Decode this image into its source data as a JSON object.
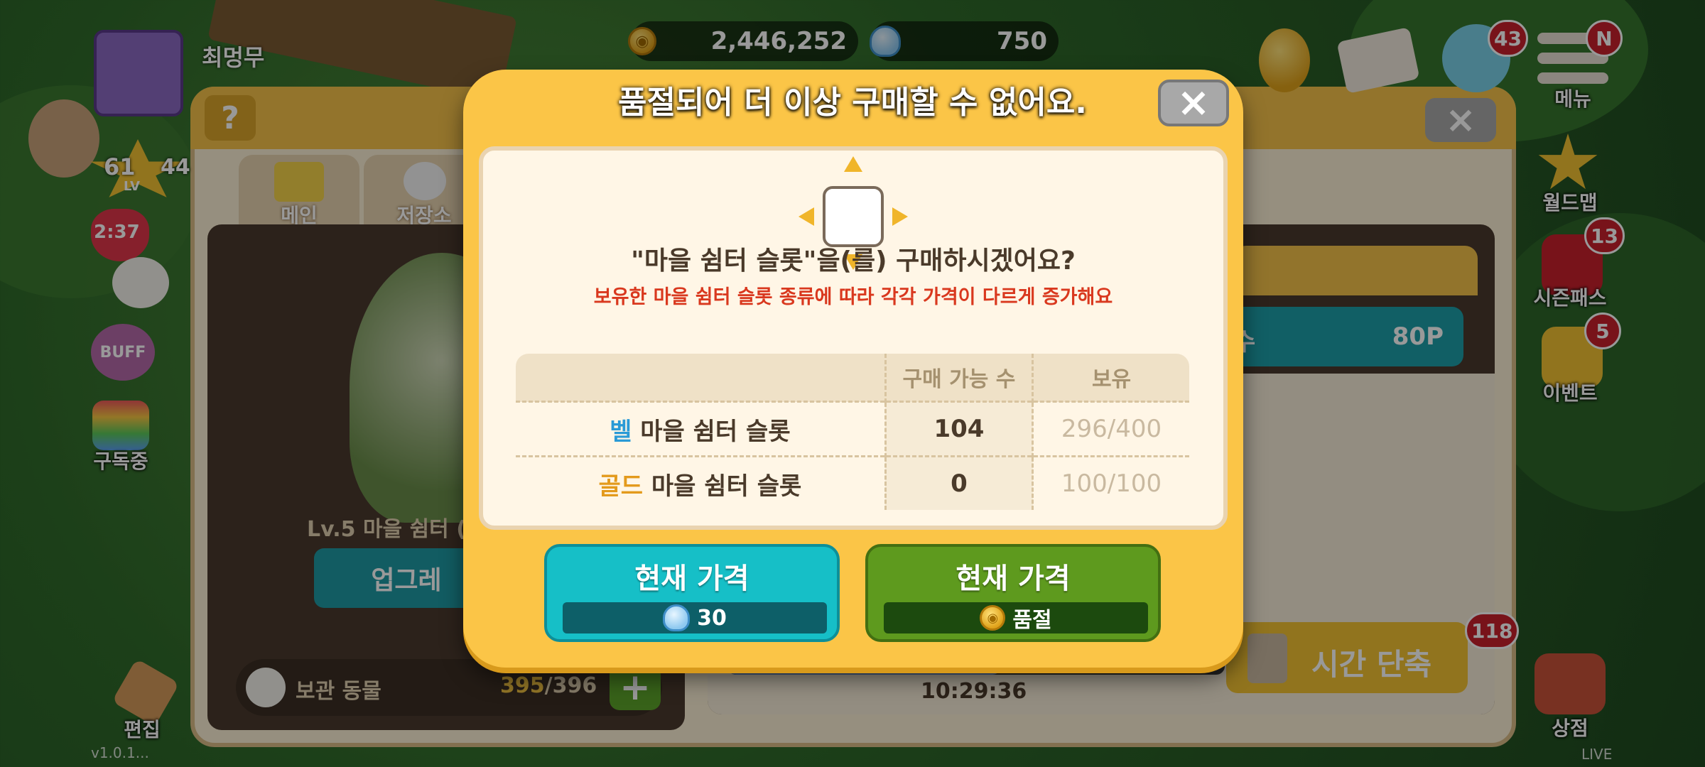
{
  "top_bar": {
    "player_name": "최멍무",
    "gold_amount": "2,446,252",
    "bell_amount": "750",
    "friends_badge": "43",
    "menu_badge": "N",
    "menu_label": "메뉴"
  },
  "left_hud": {
    "level": "61",
    "level_suffix": "LV",
    "level_partial": "44",
    "heart_timer": "2:37",
    "buff_label": "BUFF",
    "subscribe_label": "구독중",
    "edit_label": "편집",
    "version": "v1.0.1..."
  },
  "right_hud": {
    "worldmap_label": "월드맵",
    "seasonpass_label": "시즌패스",
    "seasonpass_badge": "13",
    "event_label": "이벤트",
    "event_badge": "5",
    "shop_label": "상점",
    "live_label": "LIVE"
  },
  "background_panel": {
    "tab_main": "메인",
    "tab_storage": "저장소",
    "building_label": "Lv.5 마을 쉼터 (",
    "upgrade_label": "업그레",
    "stored_animals_label": "보관 동물",
    "stored_animals_current": "395",
    "stored_animals_max": "/396",
    "points_label": "수",
    "points_value": "80P",
    "timer": "10:29:36",
    "time_reduce_label": "시간 단축",
    "time_reduce_badge": "118"
  },
  "modal": {
    "title": "품절되어 더 이상 구매할 수 없어요.",
    "question": "\"마을 쉼터 슬롯\"을(를) 구매하시겠어요?",
    "warning": "보유한 마을 쉼터 슬롯 종류에 따라 각각 가격이 다르게 증가해요",
    "table": {
      "headers": [
        "",
        "구매 가능 수",
        "보유"
      ],
      "rows": [
        {
          "prefix": "벨",
          "name": " 마을 쉼터 슬롯",
          "available": "104",
          "owned": "296/400"
        },
        {
          "prefix": "골드",
          "name": " 마을 쉼터 슬롯",
          "available": "0",
          "owned": "100/100"
        }
      ]
    },
    "bell_button": {
      "label": "현재 가격",
      "price": "30"
    },
    "gold_button": {
      "label": "현재 가격",
      "price": "품절"
    }
  },
  "colors": {
    "modal_bg": "#fbc547",
    "bell_button": "#16bfc7",
    "gold_button": "#5e9a1e",
    "warning_text": "#d9381e",
    "badge_red": "#c8202c"
  }
}
